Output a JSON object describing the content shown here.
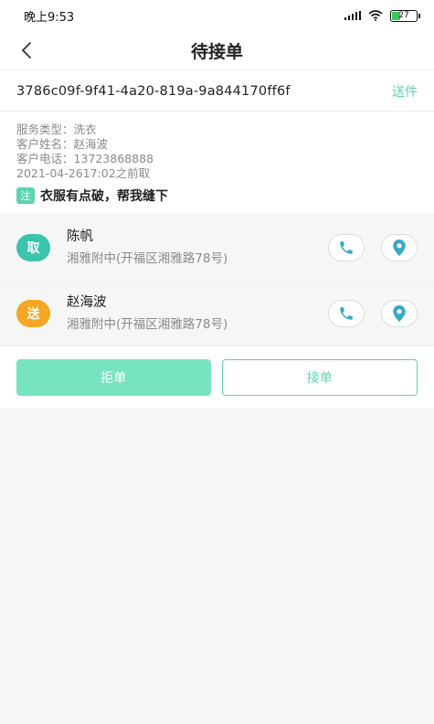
{
  "status_bar": {
    "time": "晚上9:53",
    "battery": "27"
  },
  "nav": {
    "title": "待接单"
  },
  "order": {
    "id": "3786c09f-9f41-4a20-819a-9a844170ff6f",
    "type": "送件",
    "service_type": "服务类型：洗衣",
    "customer_name": "客户姓名：赵海波",
    "customer_phone": "客户电话：13723868888",
    "pickup_time": "2021-04-2617:02之前取",
    "note_tag": "注",
    "note": "衣服有点破，帮我缝下"
  },
  "stops": [
    {
      "badge": "取",
      "name": "陈帆",
      "address": "湘雅附中(开福区湘雅路78号)"
    },
    {
      "badge": "送",
      "name": "赵海波",
      "address": "湘雅附中(开福区湘雅路78号)"
    }
  ],
  "actions": {
    "reject": "拒单",
    "accept": "接单"
  },
  "colors": {
    "accent": "#5fd3b0",
    "pickup_badge": "#3ac4ab",
    "send_badge": "#f5a623",
    "reject_button": "#78e3c0"
  },
  "icons": [
    "back-arrow-icon",
    "signal-icon",
    "wifi-icon",
    "battery-icon",
    "phone-icon",
    "location-pin-icon"
  ]
}
